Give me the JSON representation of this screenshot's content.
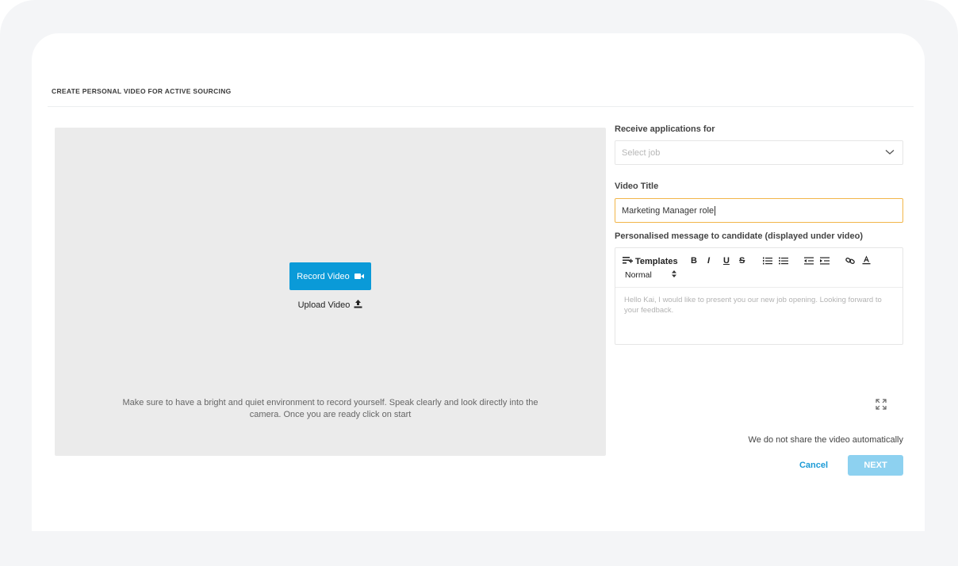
{
  "page": {
    "title": "CREATE PERSONAL VIDEO FOR ACTIVE SOURCING"
  },
  "video_panel": {
    "record_label": "Record Video",
    "upload_label": "Upload Video",
    "instructions": "Make sure to have a bright and quiet environment to record yourself. Speak clearly and look directly into the camera. Once you are ready click on start"
  },
  "form": {
    "job_label": "Receive applications for",
    "job_placeholder": "Select job",
    "title_label": "Video Title",
    "title_value": "Marketing Manager role",
    "message_label": "Personalised message to candidate (displayed under video)",
    "toolbar": {
      "templates_label": "Templates",
      "bold": "B",
      "italic": "I",
      "underline": "U",
      "strike": "S",
      "style_value": "Normal"
    },
    "message_placeholder": "Hello Kai, I would like to present you our new job opening. Looking forward to your feedback."
  },
  "footer": {
    "share_note": "We do not share the video automatically",
    "cancel_label": "Cancel",
    "next_label": "NEXT"
  },
  "colors": {
    "accent": "#0a9ad8",
    "next_disabled": "#8dd1f0",
    "input_focus": "#f2b64a",
    "video_bg": "#ebebeb"
  }
}
